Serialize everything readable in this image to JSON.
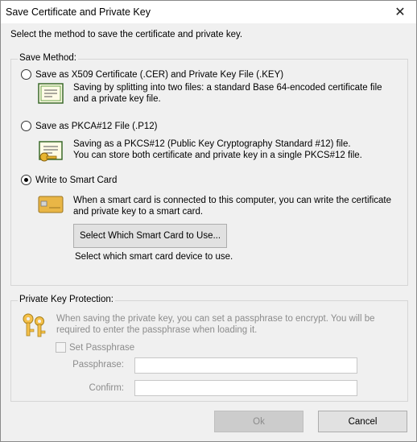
{
  "window": {
    "title": "Save Certificate and Private Key",
    "close_glyph": "✕"
  },
  "intro_text": "Select the method to save the certificate and private key.",
  "save_method": {
    "legend": "Save Method:",
    "options": [
      {
        "label": "Save as X509 Certificate (.CER) and Private Key File (.KEY)",
        "icon": "certificate-document-icon",
        "desc1": "Saving by splitting into two files: a standard Base 64-encoded certificate file",
        "desc2": "and a private key file."
      },
      {
        "label": "Save as PKCA#12 File (.P12)",
        "icon": "pkcs12-key-certificate-icon",
        "desc1": "Saving as a PKCS#12 (Public Key Cryptography Standard #12) file.",
        "desc2": "You can store both certificate and private key in a single PKCS#12 file."
      },
      {
        "label": "Write to Smart Card",
        "icon": "smart-card-icon",
        "selected": true,
        "desc1": "When a smart card is connected to this computer, you can write the certificate",
        "desc2": "and private key to a smart card."
      }
    ],
    "select_card_button": "Select Which Smart Card to Use...",
    "select_card_hint": "Select which smart card device to use."
  },
  "private_key": {
    "legend": "Private Key Protection:",
    "icon": "keys-icon",
    "desc1": "When saving the private key, you can set a passphrase to encrypt. You will be",
    "desc2": "required to enter the passphrase when loading it.",
    "set_passphrase_label": "Set Passphrase",
    "passphrase_label": "Passphrase:",
    "passphrase_value": "",
    "confirm_label": "Confirm:",
    "confirm_value": ""
  },
  "footer": {
    "ok_label": "Ok",
    "cancel_label": "Cancel"
  },
  "colors": {
    "dialog_bg": "#f0f0f0",
    "disabled_text": "#8c8c8c",
    "button_bg": "#e1e1e1"
  }
}
